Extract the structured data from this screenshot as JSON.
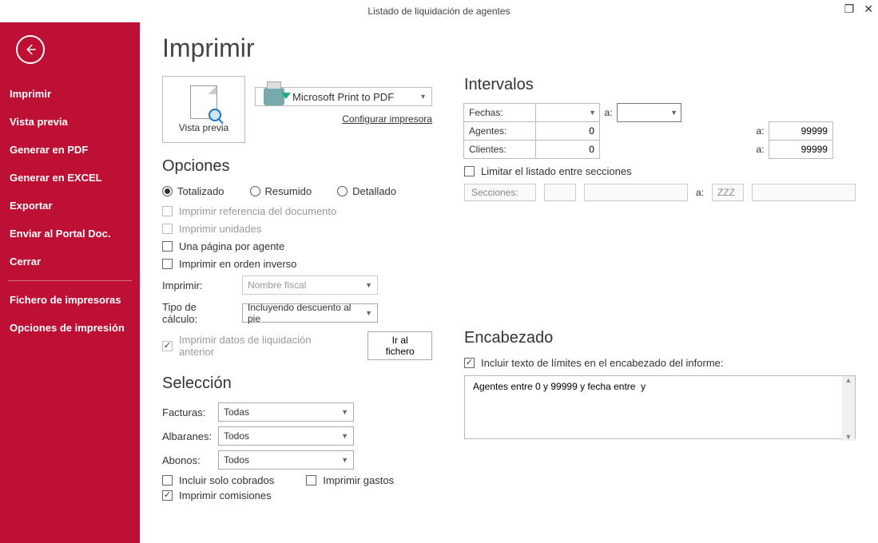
{
  "window_title": "Listado de liquidación de agentes",
  "page_title": "Imprimir",
  "sidebar": {
    "items": [
      "Imprimir",
      "Vista previa",
      "Generar en PDF",
      "Generar en EXCEL",
      "Exportar",
      "Enviar al Portal Doc.",
      "Cerrar"
    ],
    "items2": [
      "Fichero de impresoras",
      "Opciones de impresión"
    ]
  },
  "preview_label": "Vista previa",
  "printer_name": "Microsoft Print to PDF",
  "config_printer_link": "Configurar impresora",
  "options": {
    "title": "Opciones",
    "radios": {
      "totalizado": "Totalizado",
      "resumido": "Resumido",
      "detallado": "Detallado"
    },
    "chk_imprimir_ref": "Imprimir referencia del documento",
    "chk_imprimir_unidades": "Imprimir unidades",
    "chk_una_pagina": "Una página por agente",
    "chk_orden_inverso": "Imprimir en orden inverso",
    "lbl_imprimir": "Imprimir:",
    "val_imprimir": "Nombre fiscal",
    "lbl_tipo_calculo": "Tipo de cálculo:",
    "val_tipo_calculo": "Incluyendo descuento al pie",
    "chk_datos_liq": "Imprimir datos de liquidación anterior",
    "btn_ir_fichero": "Ir al fichero"
  },
  "seleccion": {
    "title": "Selección",
    "lbl_facturas": "Facturas:",
    "val_facturas": "Todas",
    "lbl_albaranes": "Albaranes:",
    "val_albaranes": "Todos",
    "lbl_abonos": "Abonos:",
    "val_abonos": "Todos",
    "chk_solo_cobrados": "Incluir solo cobrados",
    "chk_imprimir_gastos": "Imprimir gastos",
    "chk_imprimir_comisiones": "Imprimir comisiones"
  },
  "intervalos": {
    "title": "Intervalos",
    "lbl_fechas": "Fechas:",
    "lbl_a": "a:",
    "lbl_agentes": "Agentes:",
    "val_agentes_from": "0",
    "val_agentes_to": "99999",
    "lbl_clientes": "Clientes:",
    "val_clientes_from": "0",
    "val_clientes_to": "99999",
    "chk_limitar": "Limitar el listado entre secciones",
    "lbl_secciones": "Secciones:",
    "val_secciones_to": "ZZZ"
  },
  "encabezado": {
    "title": "Encabezado",
    "chk_incluir_texto": "Incluir texto de límites en el encabezado del informe:",
    "textarea_value": "Agentes entre 0 y 99999 y fecha entre  y"
  }
}
